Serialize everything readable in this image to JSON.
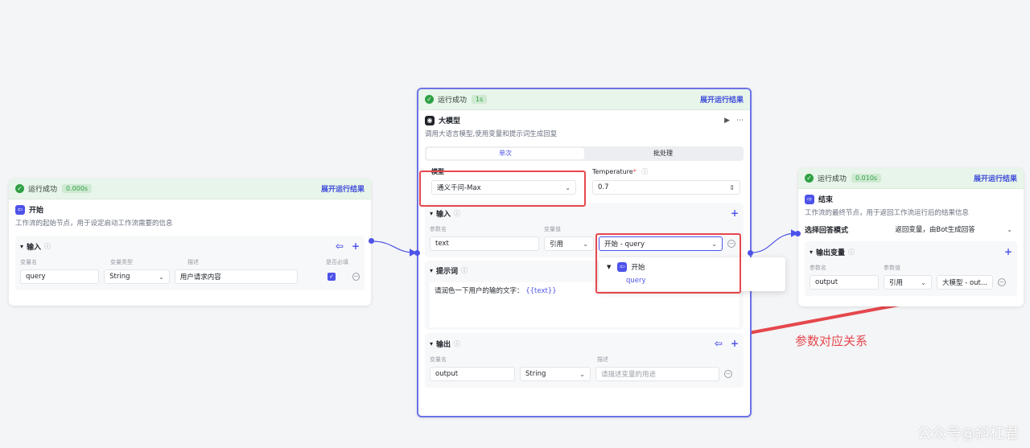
{
  "start_node": {
    "status": "运行成功",
    "time": "0.000s",
    "expand_label": "展开运行结果",
    "title": "开始",
    "desc": "工作流的起始节点，用于设定启动工作流需要的信息",
    "input_section": {
      "label": "输入",
      "columns": [
        "变量名",
        "变量类型",
        "描述",
        "是否必填"
      ],
      "row": {
        "name": "query",
        "type": "String",
        "desc": "用户请求内容"
      }
    }
  },
  "llm_node": {
    "status": "运行成功",
    "time": "1s",
    "expand_label": "展开运行结果",
    "title": "大模型",
    "desc": "调用大语言模型,使用变量和提示词生成回复",
    "tabs": [
      "单次",
      "批处理"
    ],
    "model": {
      "label": "模型",
      "value": "通义千问-Max"
    },
    "temperature": {
      "label": "Temperature",
      "required_mark": "*",
      "value": "0.7"
    },
    "input_section": {
      "label": "输入",
      "columns": [
        "参数名",
        "变量值"
      ],
      "row": {
        "name": "text",
        "mode": "引用",
        "ref": "开始 - query"
      }
    },
    "ref_popup": {
      "group": "开始",
      "item": "query"
    },
    "prompt_section": {
      "label": "提示词",
      "text": "请润色一下用户的输的文字：",
      "var": "{{text}}"
    },
    "output_section": {
      "label": "输出",
      "columns": [
        "变量名",
        "描述"
      ],
      "row": {
        "name": "output",
        "type": "String",
        "desc_placeholder": "请描述变量的用途"
      }
    }
  },
  "end_node": {
    "status": "运行成功",
    "time": "0.010s",
    "expand_label": "展开运行结果",
    "title": "结束",
    "desc": "工作流的最终节点，用于返回工作流运行后的结果信息",
    "answer_mode": {
      "label": "选择回答模式",
      "value": "返回变量，由Bot生成回答"
    },
    "output_section": {
      "label": "输出变量",
      "columns": [
        "参数名",
        "参数值"
      ],
      "row": {
        "name": "output",
        "mode": "引用",
        "ref": "大模型 - out..."
      }
    }
  },
  "annotation": "参数对应关系",
  "watermark": "公众号@斜杠君",
  "colors": {
    "accent": "#4d53e8",
    "success": "#2ea043",
    "highlight": "#e5484d"
  }
}
